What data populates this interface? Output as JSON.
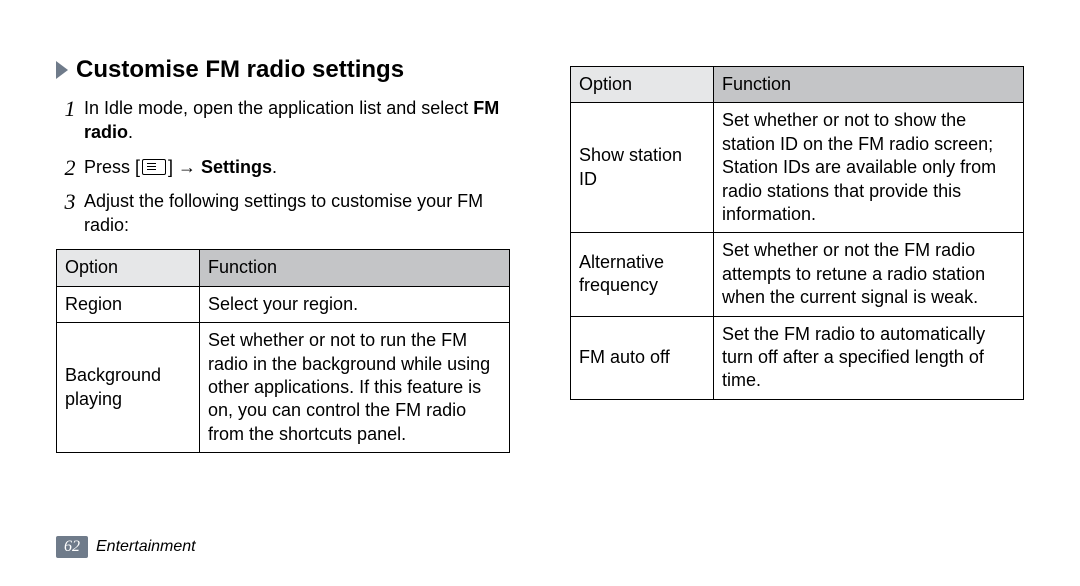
{
  "heading": "Customise FM radio settings",
  "steps": {
    "s1_num": "1",
    "s1_a": "In Idle mode, open the application list and select ",
    "s1_b": "FM radio",
    "s1_c": ".",
    "s2_num": "2",
    "s2_a": "Press [",
    "s2_b": "] → ",
    "s2_c": "Settings",
    "s2_d": ".",
    "s3_num": "3",
    "s3_a": "Adjust the following settings to customise your FM radio:"
  },
  "table_headers": {
    "option": "Option",
    "function": "Function"
  },
  "table_left": {
    "r1_opt": "Region",
    "r1_fn": "Select your region.",
    "r2_opt": "Background playing",
    "r2_fn": "Set whether or not to run the FM radio in the background while using other applications. If this feature is on, you can control the FM radio from the shortcuts panel."
  },
  "table_right": {
    "r1_opt": "Show station ID",
    "r1_fn": "Set whether or not to show the station ID on the FM radio screen; Station IDs are available only from radio stations that provide this information.",
    "r2_opt": "Alternative frequency",
    "r2_fn": "Set whether or not the FM radio attempts to retune a radio station when the current signal is weak.",
    "r3_opt": "FM auto off",
    "r3_fn": "Set the FM radio to automatically turn off after a specified length of time."
  },
  "footer": {
    "page": "62",
    "category": "Entertainment"
  }
}
